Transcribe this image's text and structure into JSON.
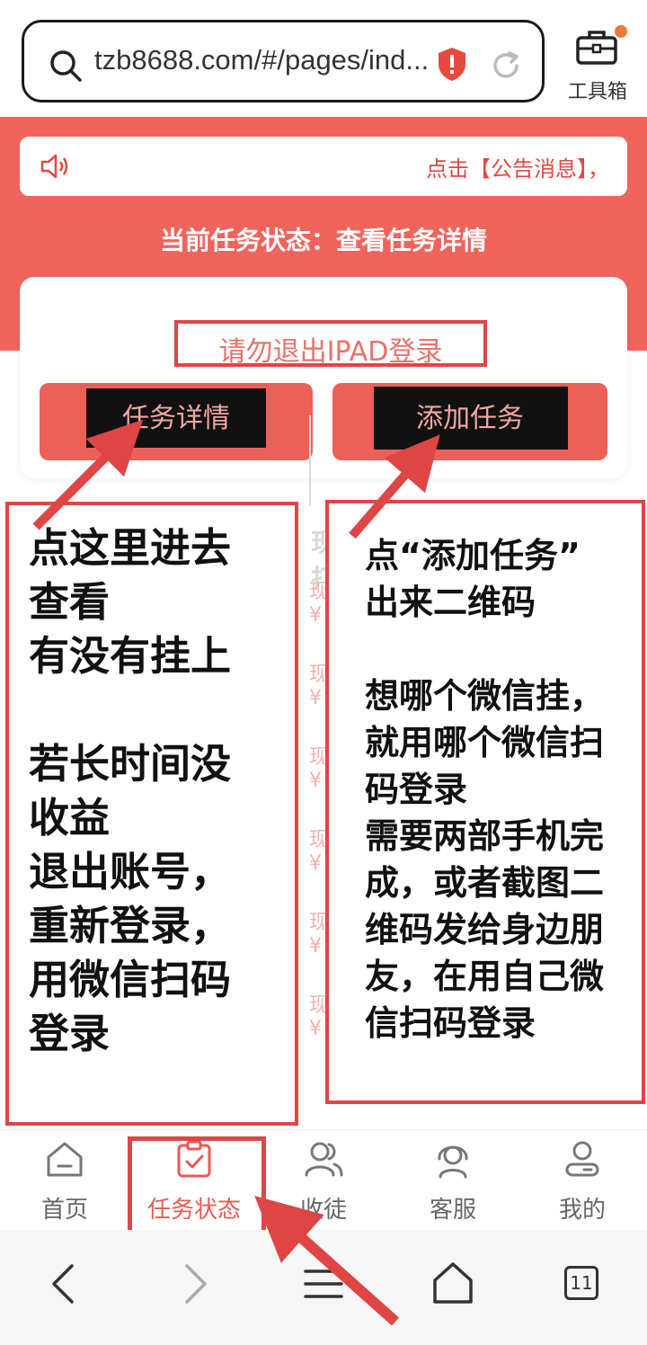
{
  "browser": {
    "url": "tzb8688.com/#/pages/ind...",
    "toolbox_label": "工具箱"
  },
  "hero": {
    "notice": "点击【公告消息】，",
    "status_line": "当前任务状态：查看任务详情"
  },
  "card": {
    "ipad_notice": "请勿退出IPAD登录",
    "detail_button": "任务详情",
    "add_button": "添加任务"
  },
  "background_list": {
    "header": "现打",
    "rows": [
      "现¥",
      "现¥",
      "现¥",
      "现¥",
      "现¥",
      "现¥"
    ]
  },
  "annotations": {
    "left": "点这里进去\n查看\n有没有挂上\n\n若长时间没\n收益\n退出账号，\n重新登录，\n用微信扫码\n登录",
    "right": "点“添加任务”\n出来二维码\n\n想哪个微信挂，\n就用哪个微信扫\n码登录\n需要两部手机完\n成，或者截图二\n维码发给身边朋\n友，在用自己微\n信扫码登录"
  },
  "tabs": [
    {
      "label": "首页",
      "icon": "home-icon"
    },
    {
      "label": "任务状态",
      "icon": "task-clipboard-icon",
      "active": true
    },
    {
      "label": "收徒",
      "icon": "users-icon"
    },
    {
      "label": "客服",
      "icon": "headset-icon"
    },
    {
      "label": "我的",
      "icon": "profile-icon"
    }
  ],
  "nav": {
    "tabs_count": "11"
  },
  "colors": {
    "brand_red": "#f0645c",
    "annotation_red": "#e04545",
    "active_tab": "#e85a52"
  }
}
